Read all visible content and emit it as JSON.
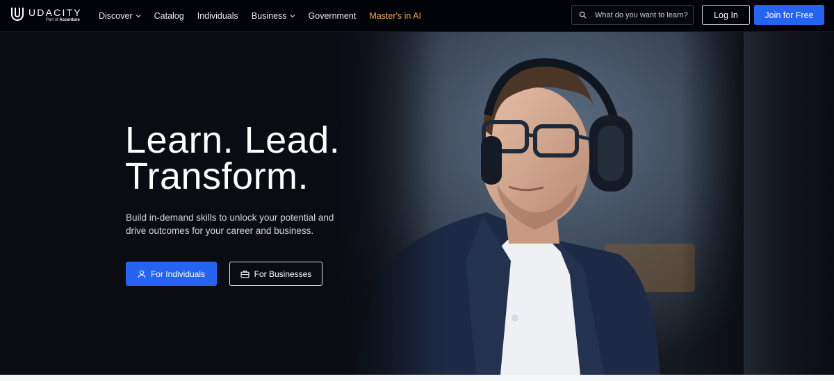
{
  "brand": {
    "name": "UDACITY",
    "tagline_prefix": "Part of",
    "tagline_company": "Accenture"
  },
  "nav": {
    "items": [
      {
        "label": "Discover",
        "dropdown": true
      },
      {
        "label": "Catalog",
        "dropdown": false
      },
      {
        "label": "Individuals",
        "dropdown": false
      },
      {
        "label": "Business",
        "dropdown": true
      },
      {
        "label": "Government",
        "dropdown": false
      },
      {
        "label": "Master's in AI",
        "dropdown": false,
        "accent": "#f0a54a"
      }
    ],
    "search_placeholder": "What do you want to learn?",
    "login_label": "Log In",
    "join_label": "Join for Free"
  },
  "hero": {
    "headline_line1": "Learn. Lead.",
    "headline_line2": "Transform.",
    "subtext": "Build in-demand skills to unlock your potential and drive outcomes for your career and business.",
    "cta_individuals": "For Individuals",
    "cta_businesses": "For Businesses"
  },
  "colors": {
    "primary": "#2563f2",
    "accent": "#f0a54a",
    "background": "#0a0c12"
  },
  "icons": {
    "logo": "udacity-u-icon",
    "search": "search-icon",
    "dropdown": "chevron-down-icon",
    "individuals": "user-icon",
    "businesses": "briefcase-icon"
  }
}
